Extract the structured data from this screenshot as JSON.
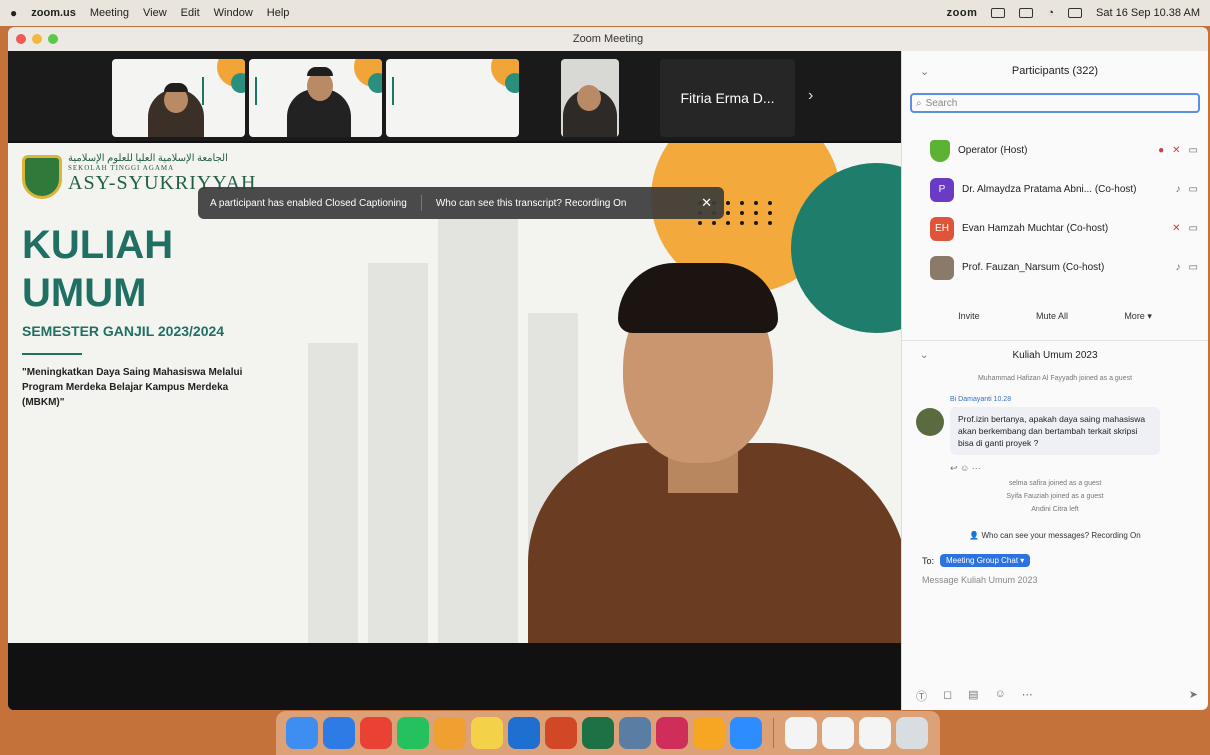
{
  "menubar": {
    "app_name": "zoom.us",
    "items": [
      "Meeting",
      "View",
      "Edit",
      "Window",
      "Help"
    ],
    "zoom_logo": "zoom",
    "datetime": "Sat 16 Sep 10.38 AM"
  },
  "window": {
    "title": "Zoom Meeting"
  },
  "gallery": {
    "name_tile": "Fitria Erma D...",
    "next_icon": "chevron-right-icon"
  },
  "caption_banner": {
    "message": "A participant has enabled Closed Captioning",
    "link": "Who can see this transcript? Recording On",
    "close": "✕"
  },
  "slide": {
    "campus_arabic": "الجامعة الإسلامية العليا للعلوم الإسلامية",
    "campus_small": "SEKOLAH TINGGI AGAMA",
    "campus_name": "ASY-SYUKRIYYAH",
    "title_line1": "KULIAH",
    "title_line2": "UMUM",
    "semester": "SEMESTER GANJIL 2023/2024",
    "quote": "\"Meningkatkan Daya Saing Mahasiswa Melalui Program Merdeka Belajar Kampus Merdeka (MBKM)\""
  },
  "participants": {
    "header": "Participants (322)",
    "search_placeholder": "Search",
    "list": [
      {
        "name": "Operator (Host)",
        "initials": "",
        "color": "#5cb233"
      },
      {
        "name": "Dr. Almaydza Pratama Abni... (Co-host)",
        "initials": "P",
        "color": "#6a3bc4"
      },
      {
        "name": "Evan Hamzah Muchtar (Co-host)",
        "initials": "EH",
        "color": "#e0553a"
      },
      {
        "name": "Prof. Fauzan_Narsum (Co-host)",
        "initials": "",
        "color": "#8a7a6a"
      }
    ],
    "buttons": {
      "invite": "Invite",
      "mute_all": "Mute All",
      "more": "More ▾"
    }
  },
  "chat": {
    "header": "Kuliah Umum 2023",
    "system_1": "Muhammad Hafizan Al Fayyadh joined as a guest",
    "sender": "Bi Damayanti  10.28",
    "message": "Prof.izin bertanya, apakah daya saing mahasiswa akan berkembang dan bertambah terkait skripsi bisa di ganti proyek ?",
    "system_2": "selma safira joined as a guest",
    "system_3": "Syifa Fauziah joined as a guest",
    "system_4": "Andini Citra left",
    "warning": "Who can see your messages? Recording On",
    "to_label": "To:",
    "to_chip": "Meeting Group Chat ▾",
    "input_placeholder": "Message Kuliah Umum 2023"
  },
  "dock_apps": [
    {
      "name": "finder",
      "color": "#3d8ef0"
    },
    {
      "name": "safari",
      "color": "#2e7be6"
    },
    {
      "name": "chrome",
      "color": "#e94235"
    },
    {
      "name": "whatsapp",
      "color": "#25c15f"
    },
    {
      "name": "photos",
      "color": "#f0a030"
    },
    {
      "name": "notes",
      "color": "#f3d24a"
    },
    {
      "name": "outlook",
      "color": "#1f6fd1"
    },
    {
      "name": "powerpoint",
      "color": "#d24726"
    },
    {
      "name": "excel",
      "color": "#1e7145"
    },
    {
      "name": "preview",
      "color": "#5a7da3"
    },
    {
      "name": "slack",
      "color": "#d02e5a"
    },
    {
      "name": "app-store",
      "color": "#f6a623"
    },
    {
      "name": "zoom",
      "color": "#2d8cff"
    }
  ]
}
